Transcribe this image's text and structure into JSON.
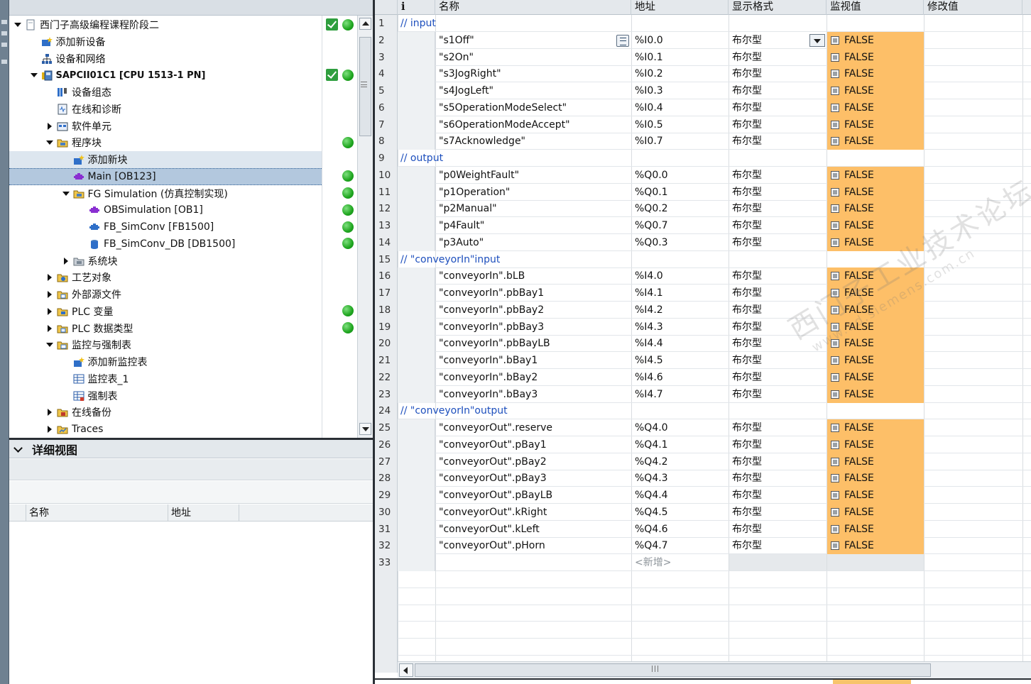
{
  "project_tree": {
    "items": [
      {
        "label": "西门子高级编程课程阶段二",
        "level": 0,
        "expander": "down",
        "icon": "project-icon",
        "status_check": true,
        "status_dot": true
      },
      {
        "label": "添加新设备",
        "level": 1,
        "expander": "none",
        "icon": "add-device-icon"
      },
      {
        "label": "设备和网络",
        "level": 1,
        "expander": "none",
        "icon": "network-icon"
      },
      {
        "label": "SAPCII01C1 [CPU 1513-1 PN]",
        "level": 1,
        "expander": "down",
        "icon": "plc-icon",
        "bold": true,
        "status_check": true,
        "status_dot": true
      },
      {
        "label": "设备组态",
        "level": 2,
        "expander": "none",
        "icon": "device-config-icon"
      },
      {
        "label": "在线和诊断",
        "level": 2,
        "expander": "none",
        "icon": "diagnostics-icon"
      },
      {
        "label": "软件单元",
        "level": 2,
        "expander": "right",
        "icon": "software-units-icon"
      },
      {
        "label": "程序块",
        "level": 2,
        "expander": "down",
        "icon": "folder-icon",
        "status_dot": true
      },
      {
        "label": "添加新块",
        "level": 3,
        "expander": "none",
        "icon": "add-block-icon",
        "highlight": "soft"
      },
      {
        "label": "Main [OB123]",
        "level": 3,
        "expander": "none",
        "icon": "ob-icon",
        "highlight": "main",
        "status_dot": true
      },
      {
        "label": "FG Simulation (仿真控制实现)",
        "level": 3,
        "expander": "down",
        "icon": "folder-icon",
        "status_dot": true
      },
      {
        "label": "OBSimulation [OB1]",
        "level": 4,
        "expander": "none",
        "icon": "ob-icon",
        "status_dot": true
      },
      {
        "label": "FB_SimConv [FB1500]",
        "level": 4,
        "expander": "none",
        "icon": "fb-icon",
        "status_dot": true
      },
      {
        "label": "FB_SimConv_DB [DB1500]",
        "level": 4,
        "expander": "none",
        "icon": "db-icon",
        "status_dot": true
      },
      {
        "label": "系统块",
        "level": 3,
        "expander": "right",
        "icon": "system-blocks-icon"
      },
      {
        "label": "工艺对象",
        "level": 2,
        "expander": "right",
        "icon": "technology-objects-icon"
      },
      {
        "label": "外部源文件",
        "level": 2,
        "expander": "right",
        "icon": "external-sources-icon"
      },
      {
        "label": "PLC 变量",
        "level": 2,
        "expander": "right",
        "icon": "plc-tags-icon",
        "status_dot": true
      },
      {
        "label": "PLC 数据类型",
        "level": 2,
        "expander": "right",
        "icon": "plc-datatypes-icon",
        "status_dot": true
      },
      {
        "label": "监控与强制表",
        "level": 2,
        "expander": "down",
        "icon": "watch-tables-icon"
      },
      {
        "label": "添加新监控表",
        "level": 3,
        "expander": "none",
        "icon": "add-watch-table-icon"
      },
      {
        "label": "监控表_1",
        "level": 3,
        "expander": "none",
        "icon": "watch-table-icon"
      },
      {
        "label": "强制表",
        "level": 3,
        "expander": "none",
        "icon": "force-table-icon"
      },
      {
        "label": "在线备份",
        "level": 2,
        "expander": "right",
        "icon": "online-backup-icon"
      },
      {
        "label": "Traces",
        "level": 2,
        "expander": "right",
        "icon": "traces-icon"
      }
    ]
  },
  "detail_view": {
    "title": "详细视图",
    "columns": [
      "名称",
      "地址"
    ]
  },
  "watch_table": {
    "columns": {
      "info": "i",
      "name": "名称",
      "address": "地址",
      "display_format": "显示格式",
      "monitor_value": "监视值",
      "modify_value": "修改值"
    },
    "rows": [
      {
        "num": "1",
        "type": "comment",
        "text": "// input"
      },
      {
        "num": "2",
        "name": "\"s1Off\"",
        "address": "%I0.0",
        "format": "布尔型",
        "value": "FALSE",
        "selected": true
      },
      {
        "num": "3",
        "name": "\"s2On\"",
        "address": "%I0.1",
        "format": "布尔型",
        "value": "FALSE"
      },
      {
        "num": "4",
        "name": "\"s3JogRight\"",
        "address": "%I0.2",
        "format": "布尔型",
        "value": "FALSE"
      },
      {
        "num": "5",
        "name": "\"s4JogLeft\"",
        "address": "%I0.3",
        "format": "布尔型",
        "value": "FALSE"
      },
      {
        "num": "6",
        "name": "\"s5OperationModeSelect\"",
        "address": "%I0.4",
        "format": "布尔型",
        "value": "FALSE"
      },
      {
        "num": "7",
        "name": "\"s6OperationModeAccept\"",
        "address": "%I0.5",
        "format": "布尔型",
        "value": "FALSE"
      },
      {
        "num": "8",
        "name": "\"s7Acknowledge\"",
        "address": "%I0.7",
        "format": "布尔型",
        "value": "FALSE"
      },
      {
        "num": "9",
        "type": "comment",
        "text": "// output"
      },
      {
        "num": "10",
        "name": "\"p0WeightFault\"",
        "address": "%Q0.0",
        "format": "布尔型",
        "value": "FALSE"
      },
      {
        "num": "11",
        "name": "\"p1Operation\"",
        "address": "%Q0.1",
        "format": "布尔型",
        "value": "FALSE"
      },
      {
        "num": "12",
        "name": "\"p2Manual\"",
        "address": "%Q0.2",
        "format": "布尔型",
        "value": "FALSE"
      },
      {
        "num": "13",
        "name": "\"p4Fault\"",
        "address": "%Q0.7",
        "format": "布尔型",
        "value": "FALSE"
      },
      {
        "num": "14",
        "name": "\"p3Auto\"",
        "address": "%Q0.3",
        "format": "布尔型",
        "value": "FALSE"
      },
      {
        "num": "15",
        "type": "comment",
        "text": "// \"conveyorIn\"input"
      },
      {
        "num": "16",
        "name": "\"conveyorIn\".bLB",
        "address": "%I4.0",
        "format": "布尔型",
        "value": "FALSE"
      },
      {
        "num": "17",
        "name": "\"conveyorIn\".pbBay1",
        "address": "%I4.1",
        "format": "布尔型",
        "value": "FALSE"
      },
      {
        "num": "18",
        "name": "\"conveyorIn\".pbBay2",
        "address": "%I4.2",
        "format": "布尔型",
        "value": "FALSE"
      },
      {
        "num": "19",
        "name": "\"conveyorIn\".pbBay3",
        "address": "%I4.3",
        "format": "布尔型",
        "value": "FALSE"
      },
      {
        "num": "20",
        "name": "\"conveyorIn\".pbBayLB",
        "address": "%I4.4",
        "format": "布尔型",
        "value": "FALSE"
      },
      {
        "num": "21",
        "name": "\"conveyorIn\".bBay1",
        "address": "%I4.5",
        "format": "布尔型",
        "value": "FALSE"
      },
      {
        "num": "22",
        "name": "\"conveyorIn\".bBay2",
        "address": "%I4.6",
        "format": "布尔型",
        "value": "FALSE"
      },
      {
        "num": "23",
        "name": "\"conveyorIn\".bBay3",
        "address": "%I4.7",
        "format": "布尔型",
        "value": "FALSE"
      },
      {
        "num": "24",
        "type": "comment",
        "text": "// \"conveyorIn\"output"
      },
      {
        "num": "25",
        "name": "\"conveyorOut\".reserve",
        "address": "%Q4.0",
        "format": "布尔型",
        "value": "FALSE"
      },
      {
        "num": "26",
        "name": "\"conveyorOut\".pBay1",
        "address": "%Q4.1",
        "format": "布尔型",
        "value": "FALSE"
      },
      {
        "num": "27",
        "name": "\"conveyorOut\".pBay2",
        "address": "%Q4.2",
        "format": "布尔型",
        "value": "FALSE"
      },
      {
        "num": "28",
        "name": "\"conveyorOut\".pBay3",
        "address": "%Q4.3",
        "format": "布尔型",
        "value": "FALSE"
      },
      {
        "num": "29",
        "name": "\"conveyorOut\".pBayLB",
        "address": "%Q4.4",
        "format": "布尔型",
        "value": "FALSE"
      },
      {
        "num": "30",
        "name": "\"conveyorOut\".kRight",
        "address": "%Q4.5",
        "format": "布尔型",
        "value": "FALSE"
      },
      {
        "num": "31",
        "name": "\"conveyorOut\".kLeft",
        "address": "%Q4.6",
        "format": "布尔型",
        "value": "FALSE"
      },
      {
        "num": "32",
        "name": "\"conveyorOut\".pHorn",
        "address": "%Q4.7",
        "format": "布尔型",
        "value": "FALSE"
      },
      {
        "num": "33",
        "type": "new",
        "text": "<新增>"
      }
    ],
    "empty_row_numbers": [
      "",
      "",
      "",
      "",
      "",
      ""
    ]
  },
  "watermark": {
    "line1": "西门子工业技术论坛",
    "line2": "www.ad.siemens.com.cn"
  },
  "colors": {
    "monitor_value_bg": "#fdbf68",
    "comment_text": "#1d4fbd",
    "status_green": "#1ea51e",
    "selection": "#b3c8de"
  }
}
